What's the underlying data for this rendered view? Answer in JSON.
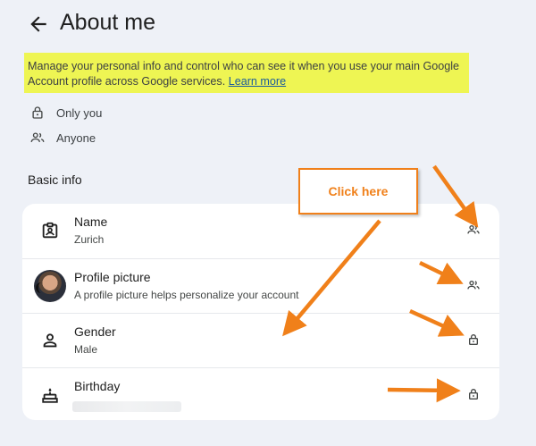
{
  "header": {
    "title": "About me",
    "back_icon": "arrow-left-icon"
  },
  "banner": {
    "text": "Manage your personal info and control who can see it when you use your main Google Account profile across Google services.",
    "link_label": "Learn more",
    "highlight_color": "#eef553"
  },
  "legend": [
    {
      "icon": "lock-icon",
      "label": "Only you"
    },
    {
      "icon": "people-icon",
      "label": "Anyone"
    }
  ],
  "basic_info": {
    "heading": "Basic info",
    "rows": [
      {
        "label": "Name",
        "value": "Zurich",
        "icon": "badge-icon",
        "visibility": "Anyone"
      },
      {
        "label": "Profile picture",
        "value": "A profile picture helps personalize your account",
        "icon": "avatar",
        "visibility": "Anyone"
      },
      {
        "label": "Gender",
        "value": "Male",
        "icon": "person-icon",
        "visibility": "Only you"
      },
      {
        "label": "Birthday",
        "value": "",
        "icon": "cake-icon",
        "visibility": "Only you"
      }
    ]
  },
  "annotation": {
    "callout_text": "Click here",
    "arrow_color": "#f0801a"
  }
}
